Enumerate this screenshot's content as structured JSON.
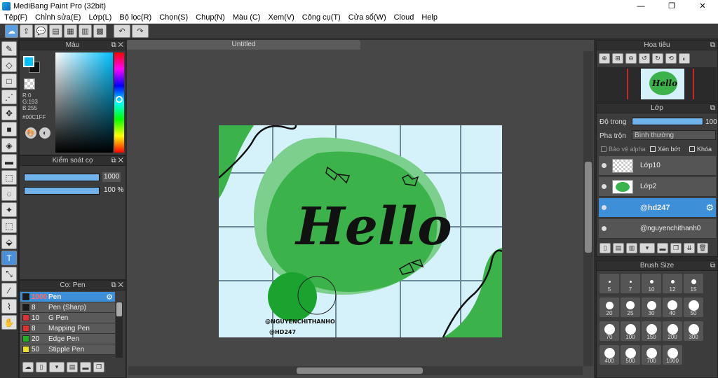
{
  "window": {
    "title": "MediBang Paint Pro (32bit)",
    "minimize": "—",
    "restore": "❐",
    "close": "✕"
  },
  "menu": [
    "Tệp(F)",
    "Chỉnh sửa(E)",
    "Lớp(L)",
    "Bộ lọc(R)",
    "Chọn(S)",
    "Chụp(N)",
    "Màu (C)",
    "Xem(V)",
    "Công cụ(T)",
    "Cửa sổ(W)",
    "Cloud",
    "Help"
  ],
  "color_panel": {
    "title": "Màu",
    "r": "R:0",
    "g": "G:193",
    "b": "B:255",
    "hex": "#00C1FF",
    "fg_color": "#00c1ff"
  },
  "brush_control": {
    "title": "Kiểm soát cọ",
    "size_value": "1000",
    "opacity_value": "100 %",
    "size_fraction": 1.0,
    "opacity_fraction": 1.0
  },
  "brush_list": {
    "title": "Cọ: Pen",
    "items": [
      {
        "size": "1000",
        "name": "Pen",
        "color": "#1a1a1a",
        "selected": true
      },
      {
        "size": "8",
        "name": "Pen (Sharp)",
        "color": "#1a1a1a"
      },
      {
        "size": "10",
        "name": "G Pen",
        "color": "#e03030"
      },
      {
        "size": "8",
        "name": "Mapping Pen",
        "color": "#e03030"
      },
      {
        "size": "20",
        "name": "Edge Pen",
        "color": "#20b020"
      },
      {
        "size": "50",
        "name": "Stipple Pen",
        "color": "#f0e020"
      }
    ]
  },
  "canvas": {
    "tab": "Untitled",
    "watermark1": "@NGUYENCHITHANHO",
    "watermark2": "@HD247",
    "art_text": "Hello"
  },
  "navigator": {
    "title": "Hoa tiêu"
  },
  "layers": {
    "title": "Lớp",
    "opacity_label": "Độ trong",
    "opacity_value": "100",
    "blend_label": "Pha trộn",
    "blend_value": "Bình thường",
    "protect_alpha": "Bảo vệ alpha",
    "clipping": "Xén bớt",
    "lock": "Khóa",
    "items": [
      {
        "name": "Lớp10",
        "selected": false
      },
      {
        "name": "Lớp2",
        "selected": false
      },
      {
        "name": "@hd247",
        "selected": true
      },
      {
        "name": "@nguyenchithanh0",
        "selected": false
      }
    ]
  },
  "brush_size": {
    "title": "Brush Size",
    "sizes": [
      "5",
      "7",
      "10",
      "12",
      "15",
      "20",
      "25",
      "30",
      "40",
      "50",
      "70",
      "100",
      "150",
      "200",
      "300",
      "400",
      "500",
      "700",
      "1000"
    ]
  }
}
